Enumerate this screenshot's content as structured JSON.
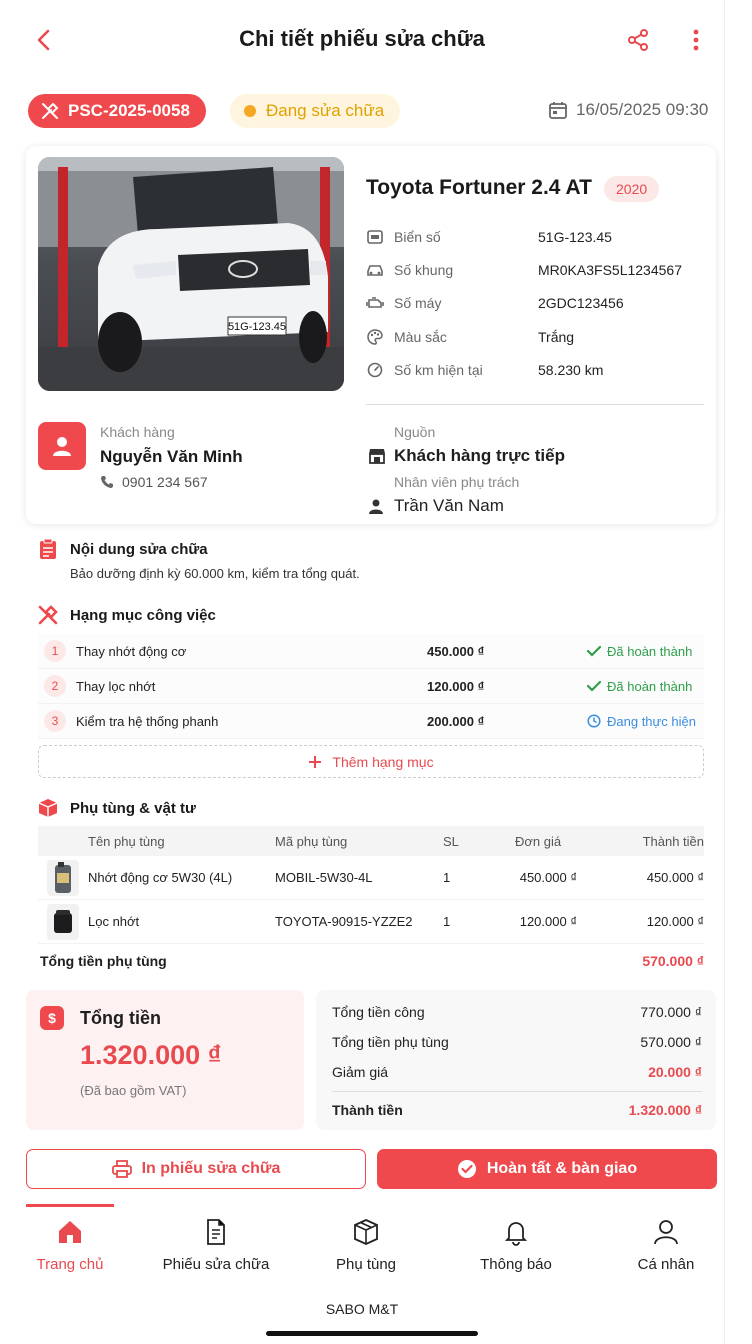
{
  "header": {
    "title": "Chi tiết phiếu sửa chữa"
  },
  "ticket": {
    "code": "PSC-2025-0058",
    "status": "Đang sửa chữa",
    "datetime": "16/05/2025 09:30"
  },
  "vehicle": {
    "plate_on_image": "51G-123.45",
    "name": "Toyota Fortuner 2.4 AT",
    "year": "2020",
    "specs": [
      {
        "icon": "license-plate-icon",
        "label": "Biển số",
        "value": "51G-123.45"
      },
      {
        "icon": "car-chassis-icon",
        "label": "Số khung",
        "value": "MR0KA3FS5L1234567"
      },
      {
        "icon": "engine-icon",
        "label": "Số máy",
        "value": "2GDC123456"
      },
      {
        "icon": "palette-icon",
        "label": "Màu sắc",
        "value": "Trắng"
      },
      {
        "icon": "speedometer-icon",
        "label": "Số km hiện tại",
        "value": "58.230 km"
      }
    ]
  },
  "customer": {
    "label": "Khách hàng",
    "name": "Nguyễn Văn Minh",
    "phone": "0901 234 567",
    "source_label": "Nguồn",
    "source": "Khách hàng trực tiếp",
    "staff_label": "Nhân viên phụ trách",
    "staff": "Trần Văn Nam"
  },
  "repair": {
    "title": "Nội dung sửa chữa",
    "description": "Bảo dưỡng định kỳ 60.000 km, kiểm tra tổng quát."
  },
  "jobs": {
    "title": "Hạng mục công việc",
    "items": [
      {
        "num": "1",
        "name": "Thay nhớt động cơ",
        "price": "450.000 ₫",
        "status": "Đã hoàn thành",
        "state": "done"
      },
      {
        "num": "2",
        "name": "Thay lọc nhớt",
        "price": "120.000 ₫",
        "status": "Đã hoàn thành",
        "state": "done"
      },
      {
        "num": "3",
        "name": "Kiểm tra hệ thống phanh",
        "price": "200.000 ₫",
        "status": "Đang thực hiện",
        "state": "progress"
      }
    ],
    "add_label": "Thêm hạng mục"
  },
  "parts": {
    "title": "Phụ tùng & vật tư",
    "columns": [
      "Tên phụ tùng",
      "Mã phụ tùng",
      "SL",
      "Đơn giá",
      "Thành tiền"
    ],
    "rows": [
      {
        "name": "Nhớt động cơ 5W30 (4L)",
        "code": "MOBIL-5W30-4L",
        "qty": "1",
        "unit_price": "450.000 ₫",
        "total": "450.000 ₫",
        "image": "oil-bottle-icon"
      },
      {
        "name": "Lọc nhớt",
        "code": "TOYOTA-90915-YZZE2",
        "qty": "1",
        "unit_price": "120.000 ₫",
        "total": "120.000 ₫",
        "image": "oil-filter-icon"
      }
    ],
    "total_label": "Tổng tiền phụ tùng",
    "total_value": "570.000 ₫"
  },
  "summary": {
    "label": "Tổng tiền",
    "amount": "1.320.000 ₫",
    "vat_note": "(Đã bao gồm VAT)",
    "labor_label": "Tổng tiền công",
    "labor_value": "770.000 ₫",
    "parts_label": "Tổng tiền phụ tùng",
    "parts_value": "570.000 ₫",
    "discount_label": "Giảm giá",
    "discount_value": "20.000 ₫",
    "final_label": "Thành tiền",
    "final_value": "1.320.000 ₫"
  },
  "actions": {
    "print_label": "In phiếu sửa chữa",
    "complete_label": "Hoàn tất & bàn giao"
  },
  "tabs": [
    {
      "label": "Trang chủ",
      "icon": "home-icon",
      "active": true
    },
    {
      "label": "Phiếu sửa chữa",
      "icon": "document-icon",
      "active": false
    },
    {
      "label": "Phụ tùng",
      "icon": "box-icon",
      "active": false
    },
    {
      "label": "Thông báo",
      "icon": "bell-icon",
      "active": false
    },
    {
      "label": "Cá nhân",
      "icon": "user-icon",
      "active": false
    }
  ],
  "brand": "SABO M&T",
  "colors": {
    "accent": "#f0494d",
    "status_pending": "#f5a623",
    "done": "#2e9e4a",
    "progress": "#3a8de0"
  }
}
